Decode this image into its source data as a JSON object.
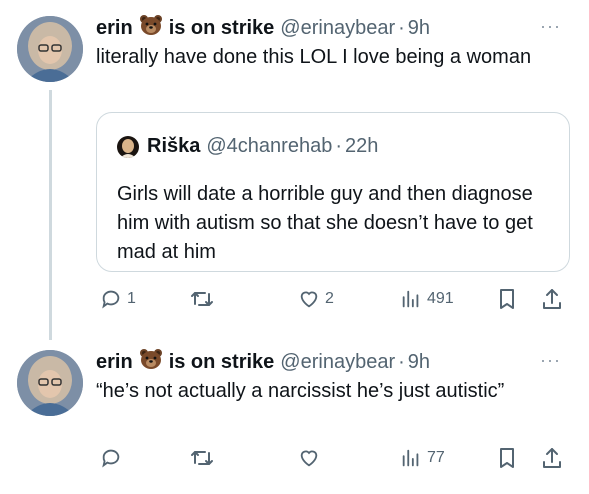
{
  "tweets": [
    {
      "display_name": "erin",
      "status": "is on strike",
      "handle": "@erinaybear",
      "separator": "·",
      "time": "9h",
      "more": "···",
      "text": "literally have done this LOL I love being a woman",
      "quote": {
        "display_name": "Riška",
        "handle": "@4chanrehab",
        "separator": "·",
        "time": "22h",
        "text": "Girls will date a horrible guy and then diagnose him with autism so that she doesn’t have to get mad at him"
      },
      "actions": {
        "reply_count": "1",
        "retweet_count": "",
        "like_count": "2",
        "view_count": "491"
      }
    },
    {
      "display_name": "erin",
      "status": "is on strike",
      "handle": "@erinaybear",
      "separator": "·",
      "time": "9h",
      "more": "···",
      "text": "“he’s not actually a narcissist he’s just autistic”",
      "actions": {
        "reply_count": "",
        "retweet_count": "",
        "like_count": "",
        "view_count": "77"
      }
    }
  ],
  "icons": [
    "bear-emoji-icon",
    "more-icon",
    "reply-icon",
    "retweet-icon",
    "like-icon",
    "views-icon",
    "bookmark-icon",
    "share-icon"
  ],
  "colors": {
    "text": "#0f1419",
    "secondary": "#536471",
    "border": "#cfd9de"
  }
}
